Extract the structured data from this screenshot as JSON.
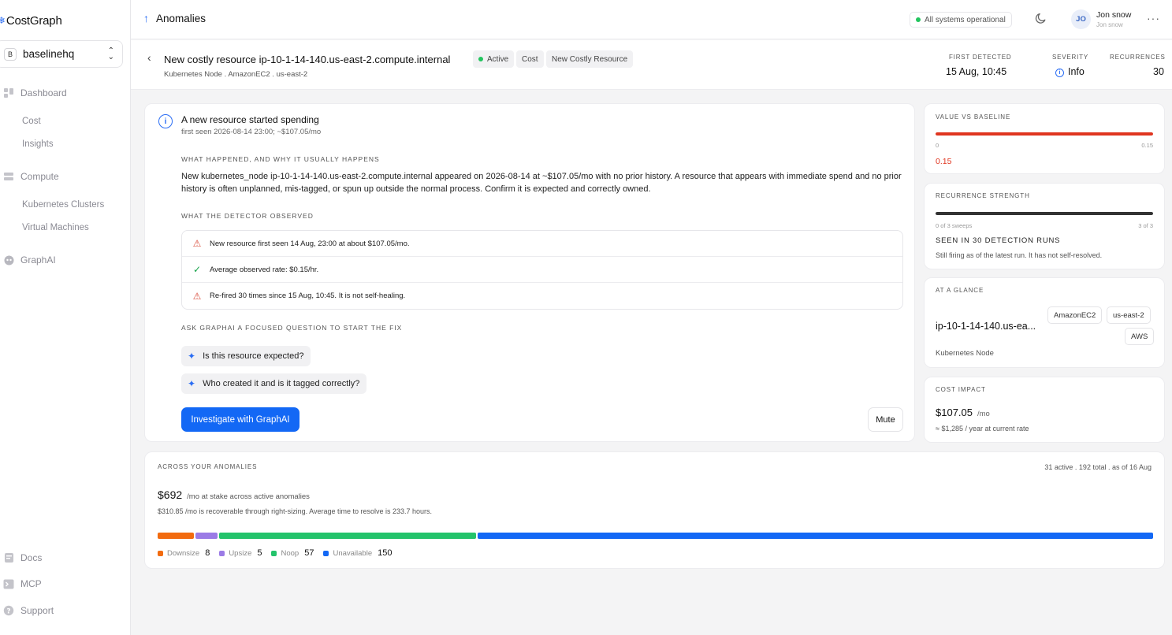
{
  "brand": {
    "name": "CostGraph"
  },
  "workspace": {
    "badge": "B",
    "name": "baselinehq"
  },
  "nav": {
    "dashboard": "Dashboard",
    "cost": "Cost",
    "insights": "Insights",
    "compute": "Compute",
    "kubernetes_clusters": "Kubernetes Clusters",
    "virtual_machines": "Virtual Machines",
    "graphai": "GraphAI",
    "docs": "Docs",
    "mcp": "MCP",
    "support": "Support"
  },
  "header": {
    "title": "Anomalies",
    "status": "All systems operational",
    "user_initials": "JO",
    "user_name": "Jon snow",
    "user_sub": "Jon snow"
  },
  "anomaly": {
    "title": "New costly resource ip-10-1-14-140.us-east-2.compute.internal",
    "tags": [
      "Active",
      "Cost",
      "New Costly Resource"
    ],
    "subtitle": "Kubernetes Node . AmazonEC2 . us-east-2",
    "first_detected_label": "FIRST DETECTED",
    "first_detected": "15 Aug, 10:45",
    "severity_label": "SEVERITY",
    "severity": "Info",
    "recurrences_label": "RECURRENCES",
    "recurrences": "30"
  },
  "main": {
    "title": "A new resource started spending",
    "subtitle": "first seen 2026-08-14 23:00; ~$107.05/mo",
    "what_label": "WHAT HAPPENED, AND WHY IT USUALLY HAPPENS",
    "what_body": "New kubernetes_node ip-10-1-14-140.us-east-2.compute.internal appeared on 2026-08-14 at ~$107.05/mo with no prior history. A resource that appears with immediate spend and no prior history is often unplanned, mis-tagged, or spun up outside the normal process. Confirm it is expected and correctly owned.",
    "observed_label": "WHAT THE DETECTOR OBSERVED",
    "observations": [
      {
        "icon": "warning",
        "text": "New resource first seen 14 Aug, 23:00 at about $107.05/mo."
      },
      {
        "icon": "check",
        "text": "Average observed rate: $0.15/hr."
      },
      {
        "icon": "warning",
        "text": "Re-fired 30 times since 15 Aug, 10:45. It is not self-healing."
      }
    ],
    "ask_label": "ASK GRAPHAI A FOCUSED QUESTION TO START THE FIX",
    "questions": [
      "Is this resource expected?",
      "Who created it and is it tagged correctly?"
    ],
    "investigate_label": "Investigate with GraphAI",
    "mute_label": "Mute"
  },
  "value_vs_baseline": {
    "label": "VALUE VS BASELINE",
    "min": "0",
    "max": "0.15",
    "value": "0.15",
    "fill_fraction": 1.0,
    "color": "#e0351f"
  },
  "recurrence": {
    "label": "RECURRENCE STRENGTH",
    "left_tick": "0 of 3 sweeps",
    "right_tick": "3 of 3",
    "fill_fraction": 1.0,
    "headline": "SEEN IN 30 DETECTION RUNS",
    "note": "Still firing as of the latest run. It has not self-resolved."
  },
  "glance": {
    "label": "AT A GLANCE",
    "resource": "ip-10-1-14-140.us-ea...",
    "type": "Kubernetes Node",
    "pills": [
      "AmazonEC2",
      "us-east-2",
      "AWS"
    ]
  },
  "cost_impact": {
    "label": "COST IMPACT",
    "value": "$107.05",
    "unit": "/mo",
    "note": "≈ $1,285 / year at current rate"
  },
  "across": {
    "label": "ACROSS YOUR ANOMALIES",
    "summary": "31 active . 192 total . as of 16 Aug",
    "value": "$692",
    "value_note": "/mo at stake across active anomalies",
    "detail": "$310.85 /mo is recoverable through right-sizing. Average time to resolve is 233.7 hours.",
    "segments": [
      {
        "name": "Downsize",
        "count": 8,
        "color": "#f26b0f"
      },
      {
        "name": "Upsize",
        "count": 5,
        "color": "#9b7be6"
      },
      {
        "name": "Noop",
        "count": 57,
        "color": "#23c36b"
      },
      {
        "name": "Unavailable",
        "count": 150,
        "color": "#1368f5"
      }
    ]
  }
}
